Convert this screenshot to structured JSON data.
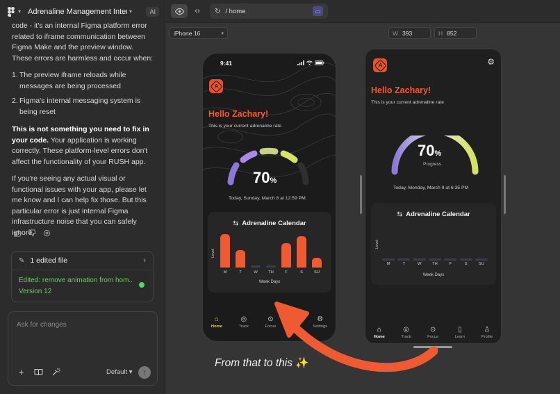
{
  "left_panel": {
    "project_title": "Adrenaline Management Interfa...",
    "ai_badge": "AI",
    "chat": {
      "intro_first": "code - it's an internal Figma platform error related to iframe communication between Figma Make and the preview window. These errors are harmless and occur when:",
      "list": [
        {
          "num": "1.",
          "text": "The preview iframe reloads while messages are being processed"
        },
        {
          "num": "2.",
          "text": "Figma's internal messaging system is being reset"
        }
      ],
      "bold_line": "This is not something you need to fix in your code.",
      "after_bold": " Your application is working correctly. These platform-level errors don't affect the functionality of your RUSH app.",
      "closing": "If you're seeing any actual visual or functional issues with your app, please let me know and I can help fix those. But this particular error is just internal Figma infrastructure noise that you can safely ignore."
    },
    "edit_card": {
      "header": "1 edited file",
      "message": "Edited: remove animation from hom...",
      "version": "Version 12"
    },
    "ask_box": {
      "placeholder": "Ask for changes",
      "model": "Default"
    }
  },
  "toolbar": {
    "url": "/ home",
    "device": "iPhone 16",
    "width_key": "W",
    "width_value": "393",
    "height_key": "H",
    "height_value": "852"
  },
  "phone_before": {
    "time": "9:41",
    "greeting": "Hello Zachary!",
    "subtitle": "This is your current adrenaline rate",
    "gauge_value": "70",
    "gauge_unit": "%",
    "date": "Today, Sunday, March 8 at 12:59 PM",
    "calendar_title": "Adrenaline Calendar",
    "level_label": "Level",
    "weekdays": [
      "M",
      "T",
      "W",
      "TH",
      "F",
      "S",
      "SU"
    ],
    "week_caption": "Week Days",
    "bar_levels": [
      0.95,
      0.5,
      0.05,
      0.05,
      0.7,
      0.9,
      0.28
    ],
    "tabs": [
      {
        "label": "Home",
        "icon": "home-icon"
      },
      {
        "label": "Track",
        "icon": "target-icon"
      },
      {
        "label": "Focus",
        "icon": "focus-icon"
      },
      {
        "label": "",
        "icon": "book-icon"
      },
      {
        "label": "Settings",
        "icon": "gear-icon"
      }
    ]
  },
  "phone_after": {
    "greeting": "Hello Zachary!",
    "subtitle": "This is your current adrenaline rate",
    "gauge_value": "70",
    "gauge_unit": "%",
    "gauge_label": "Progress",
    "date": "Today, Monday, March 9 at 6:35 PM",
    "calendar_title": "Adrenaline Calendar",
    "level_label": "Level",
    "weekdays": [
      "M",
      "T",
      "W",
      "TH",
      "F",
      "S",
      "SU"
    ],
    "week_caption": "Week Days",
    "tabs": [
      {
        "label": "Home",
        "icon": "home-icon"
      },
      {
        "label": "Track",
        "icon": "target-icon"
      },
      {
        "label": "Focus",
        "icon": "focus-icon"
      },
      {
        "label": "Learn",
        "icon": "book-icon"
      },
      {
        "label": "Profile",
        "icon": "person-icon"
      }
    ]
  },
  "caption": "From that to this",
  "colors": {
    "accent_orange": "#f05a33",
    "success_green": "#6ecb63",
    "tab_active_yellow": "#e5d44c"
  }
}
